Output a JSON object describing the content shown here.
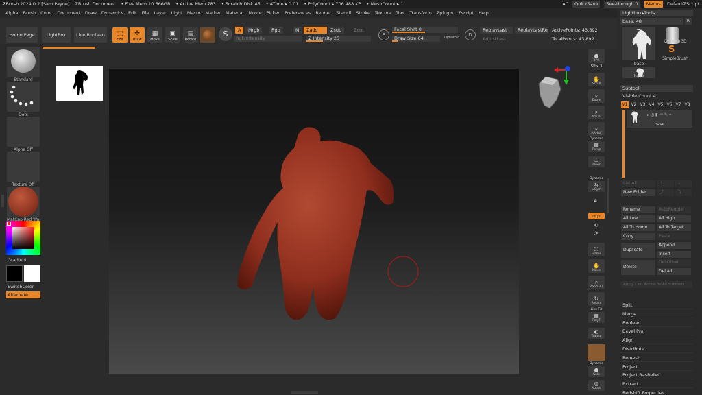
{
  "titlebar": {
    "app": "ZBrush 2024.0.2 [Sam Payne]",
    "document": "ZBrush Document",
    "free_mem": "• Free Mem 20.666GB",
    "active_mem": "• Active Mem 783",
    "scratch_disk": "• Scratch Disk 45",
    "atime": "• ATime ▸ 0.01",
    "polycount": "• PolyCount ▸ 706.488 KP",
    "meshcount": "• MeshCount ▸ 1",
    "ac": "AC",
    "quicksave": "QuickSave",
    "seethrough": "See-through  0",
    "menus": "Menus",
    "defaultzscript": "DefaultZScript"
  },
  "menus": [
    "Alpha",
    "Brush",
    "Color",
    "Document",
    "Draw",
    "Dynamics",
    "Edit",
    "File",
    "Layer",
    "Light",
    "Macro",
    "Marker",
    "Material",
    "Movie",
    "Picker",
    "Preferences",
    "Render",
    "Stencil",
    "Stroke",
    "Texture",
    "Tool",
    "Transform",
    "Zplugin",
    "Zscript",
    "Help"
  ],
  "shelf": {
    "home_page": "Home Page",
    "lightbox": "LightBox",
    "live_boolean": "Live Boolean",
    "edit": "Edit",
    "draw": "Draw",
    "move": "Move",
    "scale": "Scale",
    "rotate": "Rotate",
    "a": "A",
    "mrgb": "Mrgb",
    "rgb": "Rgb",
    "m": "M",
    "zadd": "Zadd",
    "zsub": "Zsub",
    "zcut": "Zcut",
    "rgb_intensity": "Rgb Intensity",
    "z_intensity": "Z Intensity 25",
    "z_intensity_level": 0.25,
    "focal_shift": "Focal Shift 0",
    "focal_shift_level": 0.5,
    "draw_size": "Draw Size 64",
    "draw_size_level": 0.12,
    "dynamic": "Dynamic",
    "replay_last": "ReplayLast",
    "replay_last_rel": "ReplayLastRel",
    "adjust_last": "AdjustLast",
    "active_points": "ActivePoints: 43,892",
    "total_points": "TotalPoints: 43,892"
  },
  "left": {
    "standard": "Standard",
    "dots": "Dots",
    "alpha_off": "Alpha Off",
    "texture_off": "Texture Off",
    "matcap": "MatCap Red Wax",
    "gradient": "Gradient",
    "switch_color": "SwitchColor",
    "alternate": "Alternate"
  },
  "rightbar": {
    "bpr": "BPR",
    "spix": "SPix 3",
    "scroll": "Scroll",
    "zoom": "Zoom",
    "actual": "Actual",
    "aahalf": "AAHalf",
    "dynamic_persp": "Dynamic",
    "persp": "Persp",
    "floor": "Floor",
    "dynamic_lsym": "Dynamic",
    "lsym": "L.Sym",
    "xyz": "Qxyz",
    "frame": "Frame",
    "move": "Move",
    "zoom3d": "Zoom3D",
    "rotate": "Rotate",
    "line_fill": "Line Fill",
    "polyf": "PolyF",
    "transp": "Transp",
    "dynamic_solo": "Dynamic",
    "solo": "Solo",
    "xpose": "Xpose"
  },
  "rpanel": {
    "lightbox_tools": "Lightbox▸Tools",
    "base_field": "base. 48",
    "r": "R",
    "base1": "base",
    "cylinder3d": "Cylinder3D",
    "simplebrush": "SimpleBrush",
    "base2": "base",
    "subtool": "Subtool",
    "visible_count": "Visible Count 4",
    "v_tabs": [
      "V1",
      "V2",
      "V3",
      "V4",
      "V5",
      "V6",
      "V7",
      "V8"
    ],
    "subtool_item": "base",
    "list_all": "List All",
    "new_folder": "New Folder",
    "rename": "Rename",
    "auto_reorder": "AutoReorder",
    "all_low": "All Low",
    "all_high": "All High",
    "all_to_home": "All To Home",
    "all_to_target": "All To Target",
    "copy": "Copy",
    "paste": "Paste",
    "duplicate": "Duplicate",
    "append": "Append",
    "insert": "Insert",
    "delete": "Delete",
    "del_other": "Del Other",
    "del_all": "Del All",
    "apply_last": "Apply Last Action To All Subtools",
    "actions": [
      "Split",
      "Merge",
      "Boolean",
      "Bevel Pro",
      "Align",
      "Distribute",
      "Remesh",
      "Project",
      "Project BasRelief",
      "Extract",
      "Redshift Properties"
    ]
  },
  "colors": {
    "accent": "#e8872a",
    "clay": "#8f2e1e"
  }
}
